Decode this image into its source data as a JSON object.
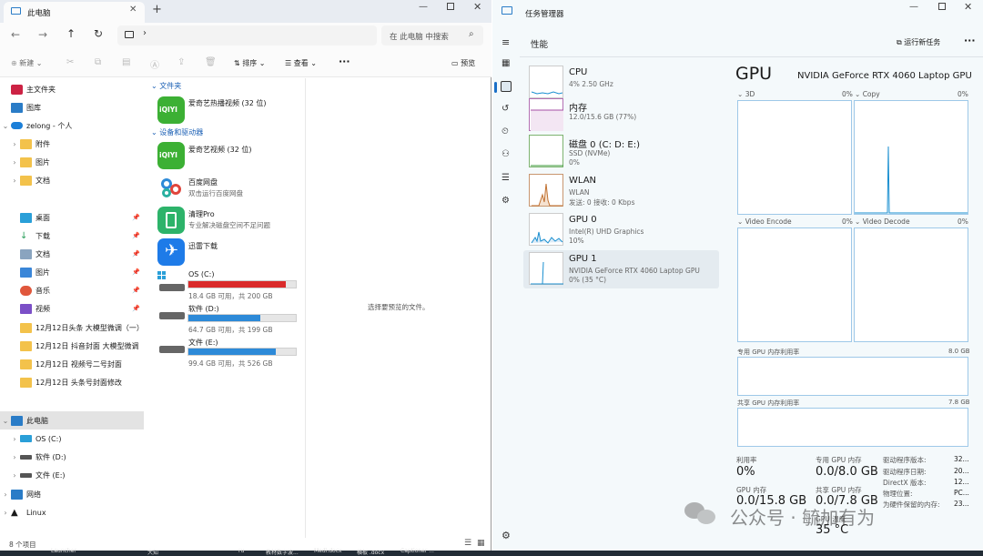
{
  "explorer": {
    "tab_title": "此电脑",
    "new_tab": "+",
    "search_placeholder": "在 此电脑 中搜索",
    "toolbar": {
      "new_label": "新建",
      "sort_label": "排序",
      "view_label": "查看",
      "more_label": "···",
      "preview_label": "预览"
    },
    "sidebar": {
      "home": "主文件夹",
      "gallery": "图库",
      "personal": "zelong - 个人",
      "cloud_items": [
        "附件",
        "图片",
        "文档"
      ],
      "quick": [
        "桌面",
        "下载",
        "文档",
        "图片",
        "音乐",
        "视频"
      ],
      "folders": [
        "12月12日头条 大模型微调（一）",
        "12月12日 抖音封面 大模型微调",
        "12月12日 视频号二号封面",
        "12月12日 头条号封面修改"
      ],
      "this_pc": "此电脑",
      "drives": [
        "OS (C:)",
        "软件 (D:)",
        "文件 (E:)"
      ],
      "network": "网络",
      "linux": "Linux"
    },
    "sections": {
      "folders": "文件夹",
      "devices": "设备和驱动器"
    },
    "folder_items": [
      {
        "name": "爱奇艺热播视频 (32 位)"
      }
    ],
    "device_items": [
      {
        "name": "爱奇艺视频 (32 位)",
        "sub": ""
      },
      {
        "name": "百度网盘",
        "sub": "双击运行百度网盘"
      },
      {
        "name": "清理Pro",
        "sub": "专业解决磁盘空间不足问题"
      },
      {
        "name": "迅雷下载",
        "sub": ""
      }
    ],
    "drives": [
      {
        "name": "OS (C:)",
        "info": "18.4 GB 可用，共 200 GB",
        "fill": 0.91,
        "color": "#da2b2b"
      },
      {
        "name": "软件 (D:)",
        "info": "64.7 GB 可用，共 199 GB",
        "fill": 0.67,
        "color": "#2d8ad8"
      },
      {
        "name": "文件 (E:)",
        "info": "99.4 GB 可用，共 526 GB",
        "fill": 0.81,
        "color": "#2d8ad8"
      }
    ],
    "preview_hint": "选择要预览的文件。",
    "status": "8 个项目",
    "iqiyi_logo": "iQIYI"
  },
  "taskmgr": {
    "title": "任务管理器",
    "page": "性能",
    "run_task": "运行新任务",
    "perf_items": [
      {
        "name": "CPU",
        "s1": "4%  2.50 GHz",
        "s2": ""
      },
      {
        "name": "内存",
        "s1": "12.0/15.6 GB (77%)",
        "s2": ""
      },
      {
        "name": "磁盘 0 (C: D: E:)",
        "s1": "SSD (NVMe)",
        "s2": "0%"
      },
      {
        "name": "WLAN",
        "s1": "WLAN",
        "s2": "发送: 0 接收: 0 Kbps"
      },
      {
        "name": "GPU 0",
        "s1": "Intel(R) UHD Graphics",
        "s2": "10%"
      },
      {
        "name": "GPU 1",
        "s1": "NVIDIA GeForce RTX 4060 Laptop GPU",
        "s2": "0% (35 °C)"
      }
    ],
    "gpu_title": "GPU",
    "gpu_name": "NVIDIA GeForce RTX 4060 Laptop GPU",
    "engines": [
      {
        "name": "3D",
        "pct": "0%"
      },
      {
        "name": "Copy",
        "pct": "0%"
      },
      {
        "name": "Video Encode",
        "pct": "0%"
      },
      {
        "name": "Video Decode",
        "pct": "0%"
      }
    ],
    "dedicated_label": "专用 GPU 内存利用率",
    "dedicated_max": "8.0 GB",
    "shared_label": "共享 GPU 内存利用率",
    "shared_max": "7.8 GB",
    "stats": {
      "util_label": "利用率",
      "util_value": "0%",
      "ded_label": "专用 GPU 内存",
      "ded_value": "0.0/8.0 GB",
      "gpumem_label": "GPU 内存",
      "gpumem_value": "0.0/15.8 GB",
      "shared_label": "共享 GPU 内存",
      "shared_value": "0.0/7.8 GB",
      "temp_label": "GPU 温度",
      "temp_value": "35 °C"
    },
    "info": [
      {
        "k": "驱动程序版本:",
        "v": "32..."
      },
      {
        "k": "驱动程序日期:",
        "v": "20..."
      },
      {
        "k": "DirectX 版本:",
        "v": "12..."
      },
      {
        "k": "物理位置:",
        "v": "PC..."
      },
      {
        "k": "为硬件保留的内存:",
        "v": "23..."
      }
    ]
  },
  "watermark": "公众号 · 毓加有为",
  "taskbar_items": [
    "Launcher",
    "大知",
    "ru",
    "教材数字波...",
    "Medi.docx",
    "横板 .docx",
    "Captioner ..."
  ]
}
